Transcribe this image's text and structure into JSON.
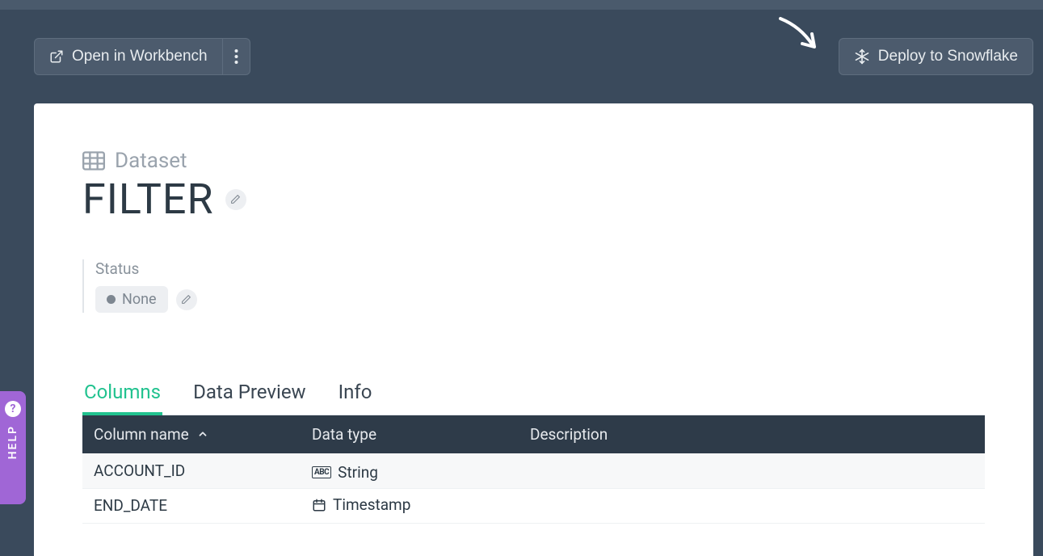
{
  "toolbar": {
    "open_workbench": "Open in Workbench",
    "deploy": "Deploy to Snowflake"
  },
  "entity": {
    "type_label": "Dataset",
    "title": "FILTER"
  },
  "status": {
    "label": "Status",
    "value": "None"
  },
  "tabs": [
    {
      "id": "columns",
      "label": "Columns",
      "active": true
    },
    {
      "id": "preview",
      "label": "Data Preview",
      "active": false
    },
    {
      "id": "info",
      "label": "Info",
      "active": false
    }
  ],
  "table": {
    "headers": {
      "name": "Column name",
      "type": "Data type",
      "desc": "Description"
    },
    "rows": [
      {
        "name": "ACCOUNT_ID",
        "type": "String",
        "type_kind": "string",
        "desc": ""
      },
      {
        "name": "END_DATE",
        "type": "Timestamp",
        "type_kind": "timestamp",
        "desc": ""
      }
    ]
  },
  "help": {
    "label": "HELP"
  }
}
